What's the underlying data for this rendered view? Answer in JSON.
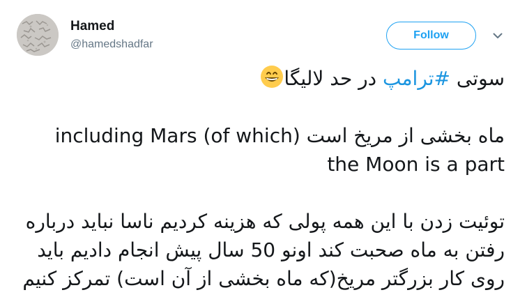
{
  "user": {
    "name": "Hamed",
    "handle": "@hamedshadfar"
  },
  "actions": {
    "follow_label": "Follow",
    "menu_icon": "chevron-down-icon"
  },
  "tweet": {
    "line1_before": "سوتی ",
    "line1_hashtag": "#ترامپ",
    "line1_after": " در حد لالیگا",
    "line1_emoji": "grinning-face-emoji",
    "line2": "ماه بخشی از مریخ است including Mars (of which",
    "line2_display": "including Mars (of which) ماه بخشی از مریخ است",
    "line3": "the Moon is a part",
    "line4": "توئیت زدن با این همه پولی که هزینه کردیم ناسا نباید درباره",
    "line5": "رفتن به ماه صحبت کند اونو 50 سال پیش انجام دادیم باید",
    "line6": "روی کار بزرگتر مریخ(که ماه بخشی از آن است) تمرکز کنیم"
  },
  "colors": {
    "accent": "#1da1f2",
    "hashtag": "#1b95e0",
    "text": "#14171a",
    "secondary": "#657786"
  }
}
